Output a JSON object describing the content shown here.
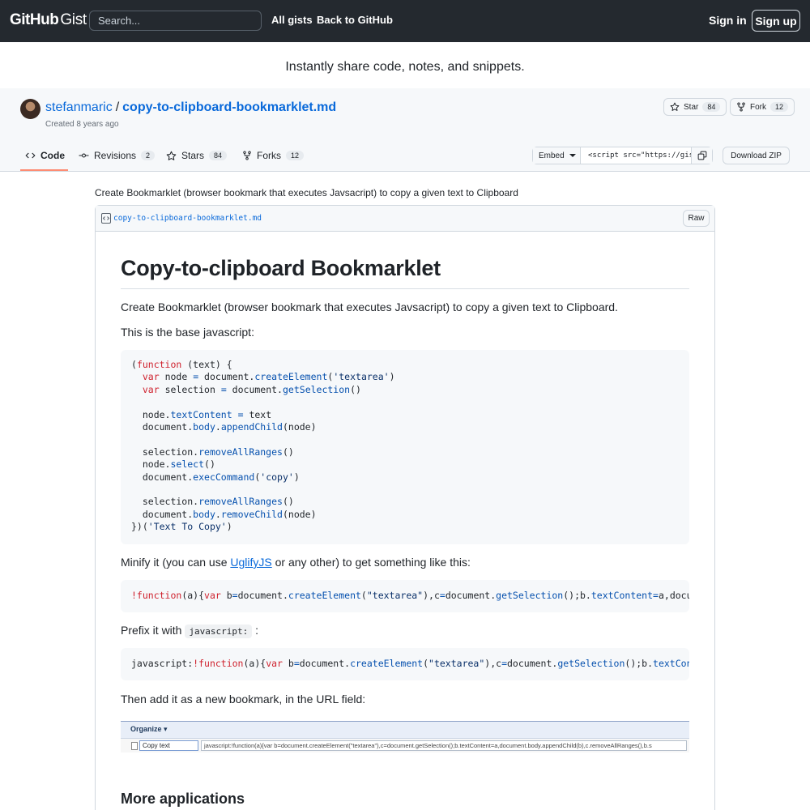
{
  "header": {
    "logo_github": "GitHub",
    "logo_gist": "Gist",
    "search_placeholder": "Search...",
    "nav": [
      "All gists",
      "Back to GitHub"
    ],
    "signin": "Sign in",
    "signup": "Sign up"
  },
  "tagline": "Instantly share code, notes, and snippets.",
  "gist": {
    "owner": "stefanmaric",
    "separator": "/",
    "filename": "copy-to-clipboard-bookmarklet.md",
    "created_prefix": "Created",
    "created_ago": "8 years ago",
    "star_label": "Star",
    "star_count": "84",
    "fork_label": "Fork",
    "fork_count": "12"
  },
  "tabs": [
    {
      "label": "Code",
      "count": ""
    },
    {
      "label": "Revisions",
      "count": "2"
    },
    {
      "label": "Stars",
      "count": "84"
    },
    {
      "label": "Forks",
      "count": "12"
    }
  ],
  "embed": {
    "label": "Embed",
    "code": "<script src=\"https://gist.github.com/stefanmaric/"
  },
  "download_zip": "Download ZIP",
  "description": "Create Bookmarklet (browser bookmark that executes Javsacript) to copy a given text to Clipboard",
  "file": {
    "name": "copy-to-clipboard-bookmarklet.md",
    "raw": "Raw"
  },
  "content": {
    "h1": "Copy-to-clipboard Bookmarklet",
    "p1": "Create Bookmarklet (browser bookmark that executes Javsacript) to copy a given text to Clipboard.",
    "p2": "This is the base javascript:",
    "p3_before": "Minify it (you can use ",
    "p3_link": "UglifyJS",
    "p3_after": " or any other) to get something like this:",
    "p4_before": "Prefix it with ",
    "p4_code": "javascript:",
    "p4_after": " :",
    "p5": "Then add it as a new bookmark, in the URL field:",
    "h2": "More applications",
    "screenshot": {
      "organize": "Organize",
      "name_field": "Copy text",
      "url_field": "javascript:!function(a){var b=document.createElement(\"textarea\"),c=document.getSelection();b.textContent=a,document.body.appendChild(b),c.removeAllRanges(),b.s"
    }
  },
  "colors": {
    "header_bg": "#24292f",
    "link": "#0969da",
    "tab_active_underline": "#fd8c73",
    "code_bg": "#f6f8fa"
  }
}
